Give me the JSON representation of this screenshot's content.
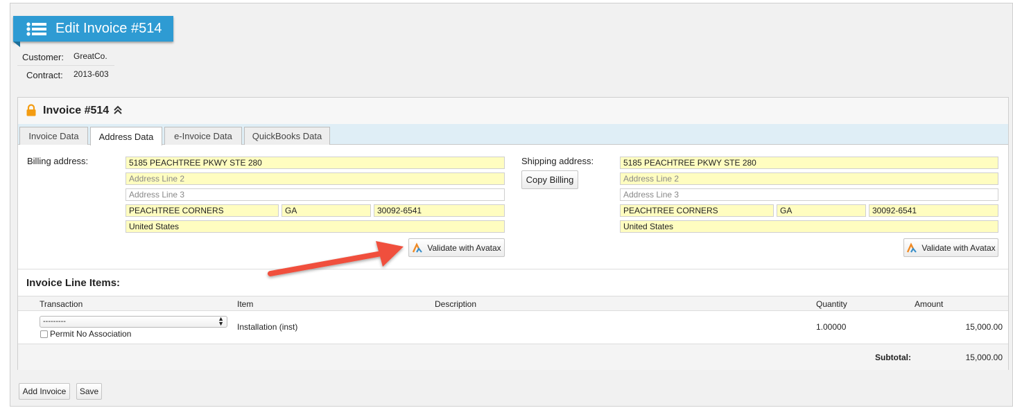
{
  "header": {
    "title": "Edit Invoice #514"
  },
  "meta": {
    "customer_label": "Customer:",
    "customer_value": "GreatCo.",
    "contract_label": "Contract:",
    "contract_value": "2013-603"
  },
  "panel": {
    "title": "Invoice #514",
    "tabs": [
      "Invoice Data",
      "Address Data",
      "e-Invoice Data",
      "QuickBooks Data"
    ],
    "active_tab": "Address Data"
  },
  "billing": {
    "label": "Billing address:",
    "line1": "5185 PEACHTREE PKWY STE 280",
    "line2_placeholder": "Address Line 2",
    "line3_placeholder": "Address Line 3",
    "city": "PEACHTREE CORNERS",
    "state": "GA",
    "zip": "30092-6541",
    "country": "United States",
    "validate_label": "Validate with Avatax"
  },
  "shipping": {
    "label": "Shipping address:",
    "copy_label": "Copy Billing",
    "line1": "5185 PEACHTREE PKWY STE 280",
    "line2_placeholder": "Address Line 2",
    "line3_placeholder": "Address Line 3",
    "city": "PEACHTREE CORNERS",
    "state": "GA",
    "zip": "30092-6541",
    "country": "United States",
    "validate_label": "Validate with Avatax"
  },
  "line_items": {
    "title": "Invoice Line Items:",
    "columns": [
      "Transaction",
      "Item",
      "Description",
      "Quantity",
      "Amount"
    ],
    "rows": [
      {
        "transaction_select": "---------",
        "permit_label": "Permit No Association",
        "item": "Installation (inst)",
        "description": "",
        "quantity": "1.00000",
        "amount": "15,000.00"
      }
    ],
    "subtotal_label": "Subtotal:",
    "subtotal_value": "15,000.00"
  },
  "actions": {
    "add_invoice": "Add Invoice",
    "save": "Save"
  },
  "colors": {
    "accent": "#2e9bd3",
    "field_highlight": "#fffdc0",
    "annotation_arrow": "#f0503c",
    "lock": "#f39c12"
  },
  "icons": [
    "list-icon",
    "lock-icon",
    "chevron-up-icon",
    "avatax-icon",
    "annotation-arrow"
  ]
}
